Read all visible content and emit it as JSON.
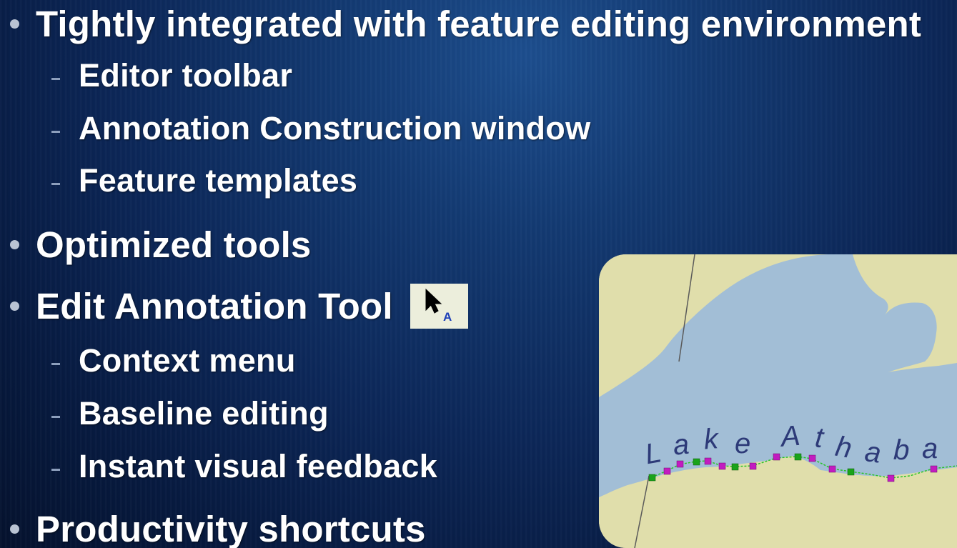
{
  "bullets": {
    "tightly_integrated": "Tightly integrated with feature editing environment",
    "editor_toolbar": "Editor toolbar",
    "annotation_construction": "Annotation Construction window",
    "feature_templates": "Feature templates",
    "optimized_tools": "Optimized tools",
    "edit_annotation_tool": "Edit Annotation Tool",
    "context_menu": "Context menu",
    "baseline_editing": "Baseline editing",
    "instant_feedback": "Instant visual feedback",
    "productivity_shortcuts": "Productivity shortcuts"
  },
  "tool_icon": {
    "name": "edit-annotation-tool-icon",
    "glyph_letter": "A"
  },
  "map": {
    "label_letters": [
      "L",
      "a",
      "k",
      "e",
      "A",
      "t",
      "h",
      "a",
      "b",
      "a"
    ],
    "colors": {
      "land": "#e0deab",
      "water": "#a2bed6",
      "text": "#2d3a78",
      "vertex_green": "#1aa31a",
      "vertex_magenta": "#c21cc0",
      "baseline": "#27c427"
    }
  },
  "colors": {
    "background_dark": "#071a3f",
    "background_light": "#1d4e8e",
    "text": "#ffffff",
    "bullet": "#b9c3d3"
  }
}
